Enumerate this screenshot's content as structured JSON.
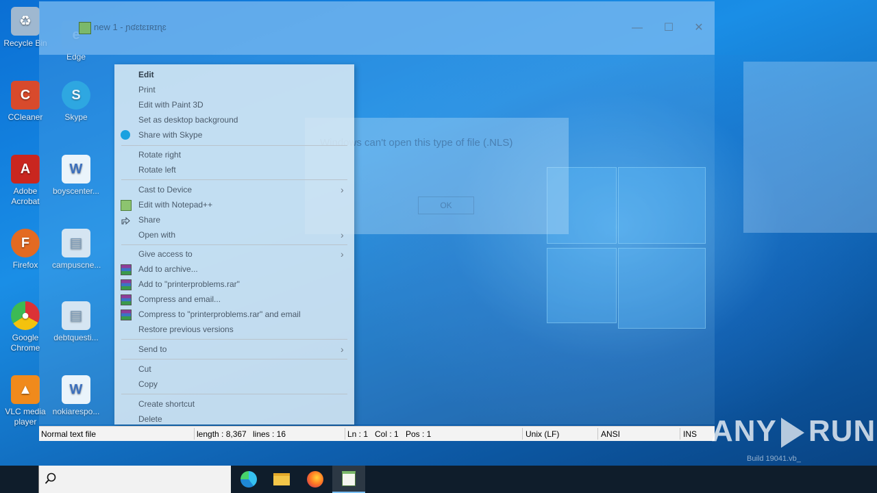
{
  "desktop": {
    "icons": [
      {
        "label": "Recycle Bin",
        "color": "#9fb8d0"
      },
      {
        "label": "CCleaner",
        "color": "#d84a2c"
      },
      {
        "label": "Adobe Acrobat",
        "color": "#c9261f"
      },
      {
        "label": "Firefox",
        "color": "#e36a22"
      },
      {
        "label": "Google Chrome",
        "color": "#2a9a47"
      },
      {
        "label": "VLC media player",
        "color": "#f08a1c"
      },
      {
        "label": "Edge",
        "color": "#1b78d0"
      },
      {
        "label": "Skype",
        "color": "#1aa1e0"
      },
      {
        "label": "boyscenter...",
        "color": "#2b5fb5"
      },
      {
        "label": "campuscne...",
        "color": "#cfd9e4"
      },
      {
        "label": "debtquesti...",
        "color": "#cfd9e4"
      },
      {
        "label": "nokiarespo...",
        "color": "#2b5fb5"
      }
    ]
  },
  "window": {
    "title": "new 1 - ɲʛɛtɛɪʀɪɳɛ",
    "minimize": "—",
    "maximize": "☐",
    "close": "✕",
    "dialog_message": "Windows can't open this type of file (.NLS)",
    "dialog_ok": "OK"
  },
  "context_menu": {
    "items": [
      {
        "label": "Edit",
        "bold": true
      },
      {
        "label": "Print"
      },
      {
        "label": "Edit with Paint 3D"
      },
      {
        "label": "Set as desktop background"
      },
      {
        "label": "Share with Skype",
        "icon": "skype-icon"
      },
      {
        "label": "Rotate right"
      },
      {
        "label": "Rotate left"
      },
      {
        "label": "Cast to Device",
        "submenu": true
      },
      {
        "label": "Edit with Notepad++",
        "icon": "notepadpp-icon"
      },
      {
        "label": "Share",
        "icon": "share-icon"
      },
      {
        "label": "Open with",
        "submenu": true
      },
      {
        "label": "Give access to",
        "submenu": true
      },
      {
        "label": "Add to archive...",
        "icon": "winrar-icon"
      },
      {
        "label": "Add to \"printerproblems.rar\"",
        "icon": "winrar-icon"
      },
      {
        "label": "Compress and email...",
        "icon": "winrar-icon"
      },
      {
        "label": "Compress to \"printerproblems.rar\" and email",
        "icon": "winrar-icon"
      },
      {
        "label": "Restore previous versions"
      },
      {
        "label": "Send to",
        "submenu": true
      },
      {
        "label": "Cut"
      },
      {
        "label": "Copy"
      },
      {
        "label": "Create shortcut"
      },
      {
        "label": "Delete"
      }
    ]
  },
  "statusbar": {
    "file_type": "Normal text file",
    "length": "length : 8,367",
    "lines": "lines : 16",
    "ln": "Ln : 1",
    "col": "Col : 1",
    "pos": "Pos : 1",
    "eol": "Unix (LF)",
    "encoding": "ANSI",
    "mode": "INS"
  },
  "watermark": {
    "brand_left": "ANY",
    "brand_right": "RUN",
    "build": "Build 19041.vb_"
  },
  "taskbar": {
    "apps": [
      "edge-icon",
      "file-explorer-icon",
      "firefox-icon",
      "notepadpp-icon"
    ]
  }
}
